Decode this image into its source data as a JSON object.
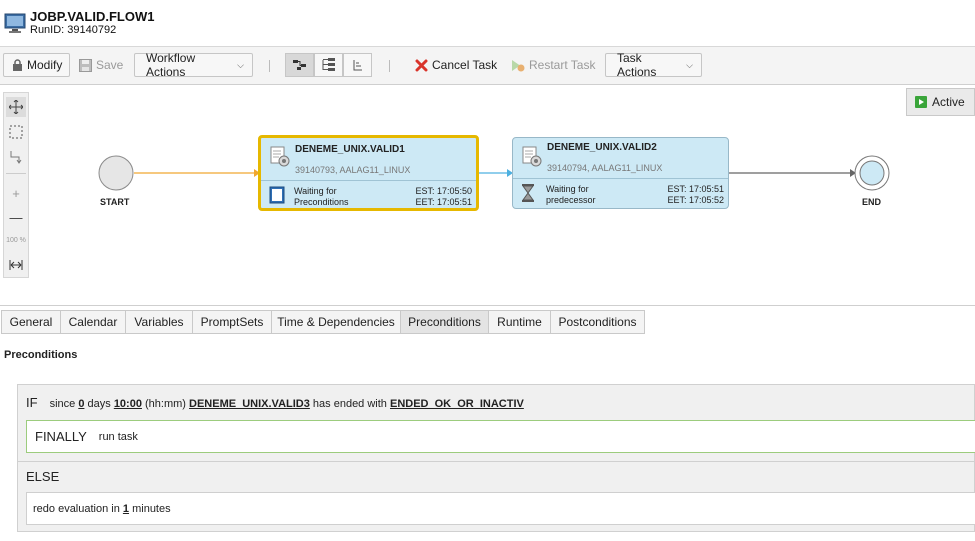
{
  "window": {
    "title": "JOBP.VALID.FLOW1",
    "runid": "RunID: 39140792",
    "icon": "monitor-icon"
  },
  "toolbar": {
    "modify_label": "Modify",
    "save_label": "Save",
    "workflow_actions_label": "Workflow Actions",
    "cancel_task_label": "Cancel Task",
    "restart_task_label": "Restart Task",
    "task_actions_label": "Task Actions"
  },
  "canvas": {
    "active_label": "Active",
    "start_label": "START",
    "end_label": "END",
    "zoom_label": "100 %",
    "nodes": [
      {
        "name": "DENEME_UNIX.VALID1",
        "sub": "39140793, AALAG11_LINUX",
        "status_line1": "Waiting for",
        "status_line2": "Preconditions",
        "est": "EST:  17:05:50",
        "eet": "EET:  17:05:51"
      },
      {
        "name": "DENEME_UNIX.VALID2",
        "sub": "39140794, AALAG11_LINUX",
        "status_line1": "Waiting for",
        "status_line2": "predecessor",
        "est": "EST:  17:05:51",
        "eet": "EET:  17:05:52"
      }
    ]
  },
  "tabs": [
    "General",
    "Calendar",
    "Variables",
    "PromptSets",
    "Time & Dependencies",
    "Preconditions",
    "Runtime",
    "Postconditions"
  ],
  "active_tab": "Preconditions",
  "preconditions": {
    "section_title": "Preconditions",
    "if_kw": "IF",
    "since": "since",
    "days_value": "0",
    "days": "days",
    "time_value": "10:00",
    "time_fmt": "(hh:mm)",
    "task": "DENEME_UNIX.VALID3",
    "has_ended": "has ended with",
    "status": "ENDED_OK_OR_INACTIV",
    "finally_kw": "FINALLY",
    "finally_action": "run task",
    "else_kw": "ELSE",
    "redo_pre": "redo evaluation in",
    "redo_value": "1",
    "redo_post": "minutes"
  },
  "colors": {
    "node_fill": "#cde9f5",
    "selected_border": "#e6b800",
    "active_green": "#3aa53a",
    "cancel_red": "#d9342b"
  }
}
